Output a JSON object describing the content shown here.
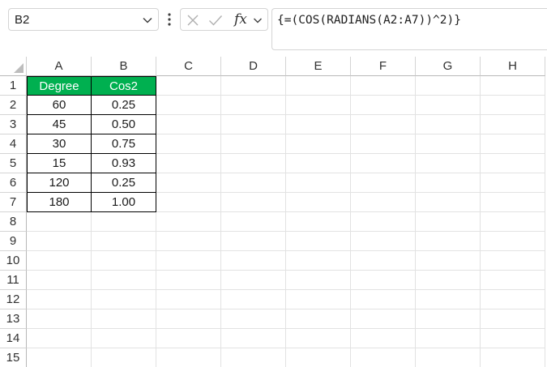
{
  "formula_bar": {
    "name_box": "B2",
    "fx_label": "fx",
    "formula": "{=(COS(RADIANS(A2:A7))^2)}"
  },
  "columns": [
    "A",
    "B",
    "C",
    "D",
    "E",
    "F",
    "G",
    "H"
  ],
  "rows": [
    "1",
    "2",
    "3",
    "4",
    "5",
    "6",
    "7",
    "8",
    "9",
    "10",
    "11",
    "12",
    "13",
    "14",
    "15"
  ],
  "table": {
    "header": [
      "Degree",
      "Cos2"
    ],
    "rows": [
      [
        "60",
        "0.25"
      ],
      [
        "45",
        "0.50"
      ],
      [
        "30",
        "0.75"
      ],
      [
        "15",
        "0.93"
      ],
      [
        "120",
        "0.25"
      ],
      [
        "180",
        "1.00"
      ]
    ],
    "header_color": "#00b050"
  }
}
